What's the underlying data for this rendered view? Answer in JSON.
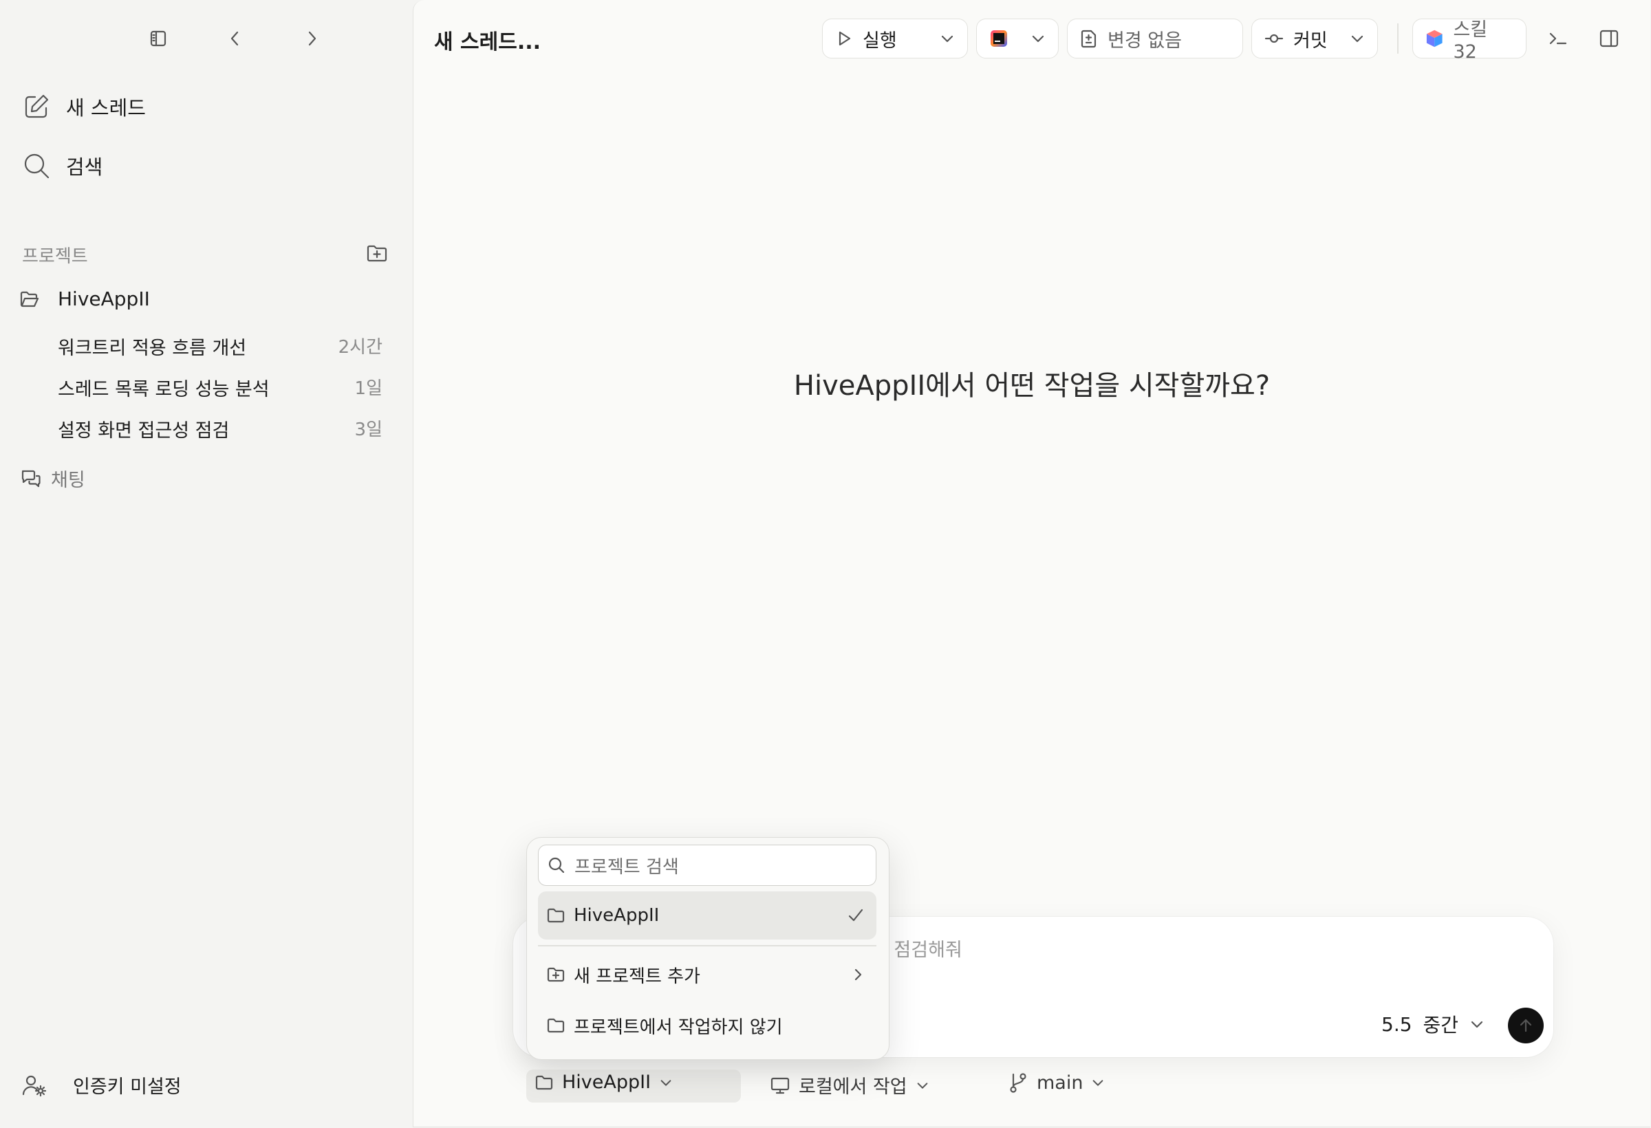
{
  "sidebar": {
    "new_thread": "새 스레드",
    "search": "검색",
    "projects_label": "프로젝트",
    "project": {
      "name": "HiveAppII"
    },
    "threads": [
      {
        "title": "워크트리 적용 흐름 개선",
        "time": "2시간"
      },
      {
        "title": "스레드 목록 로딩 성능 분석",
        "time": "1일"
      },
      {
        "title": "설정 화면 접근성 점검",
        "time": "3일"
      }
    ],
    "chat": "채팅",
    "auth": "인증키 미설정"
  },
  "header": {
    "title": "새 스레드...",
    "run_label": "실행",
    "changes_label": "변경 없음",
    "commit_label": "커밋",
    "skills_label": "스킬 32"
  },
  "main": {
    "headline": "HiveAppII에서 어떤 작업을 시작할까요?"
  },
  "composer": {
    "placeholder_visible": "을 점검해줘",
    "model": "5.5",
    "effort": "중간"
  },
  "bottom_bar": {
    "project": "HiveAppII",
    "mode": "로컬에서 작업",
    "branch": "main"
  },
  "dropdown": {
    "search_placeholder": "프로젝트 검색",
    "items": [
      {
        "label": "HiveAppII",
        "selected": true
      },
      {
        "label": "새 프로젝트 추가"
      },
      {
        "label": "프로젝트에서 작업하지 않기"
      }
    ]
  },
  "colors": {
    "sidebar_bg": "#f4f4f2",
    "main_bg": "#fafaf8",
    "send_button": "#111111",
    "muted_text": "#8a8a8a"
  }
}
